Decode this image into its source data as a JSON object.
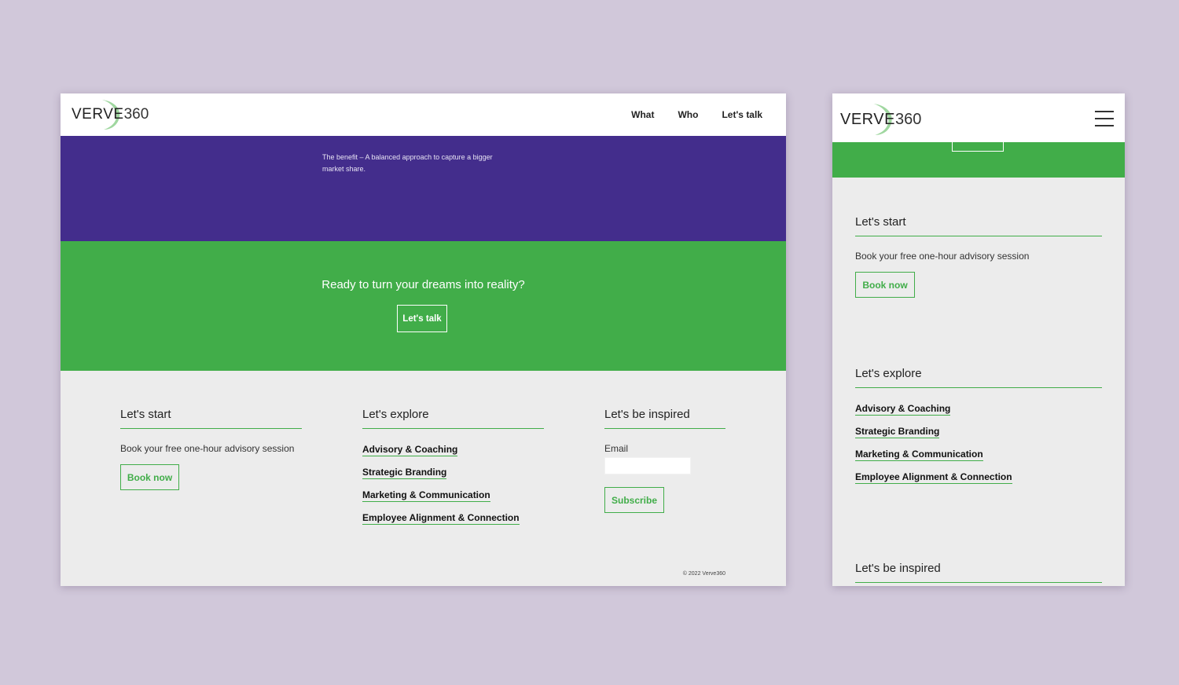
{
  "brand": {
    "word": "VERVE",
    "number": "360",
    "accent": "#41ad49",
    "purple": "#432d8c"
  },
  "nav": {
    "items": [
      "What",
      "Who",
      "Let's talk"
    ]
  },
  "hero": {
    "benefit_line1": "The benefit – A balanced approach to capture a bigger",
    "benefit_line2": "market share."
  },
  "cta": {
    "heading": "Ready to turn your dreams into reality?",
    "button": "Let's talk"
  },
  "footer": {
    "start": {
      "title": "Let's start",
      "text": "Book your free one-hour advisory session",
      "button": "Book now"
    },
    "explore": {
      "title": "Let's explore",
      "links": [
        "Advisory & Coaching",
        "Strategic Branding",
        "Marketing & Communication",
        "Employee Alignment & Connection"
      ]
    },
    "inspired": {
      "title": "Let's be inspired",
      "email_label": "Email",
      "email_value": "",
      "button": "Subscribe"
    },
    "copyright": "© 2022 Verve360"
  },
  "icons": {
    "menu": "hamburger-icon",
    "logo_mark": "swoosh-icon"
  }
}
